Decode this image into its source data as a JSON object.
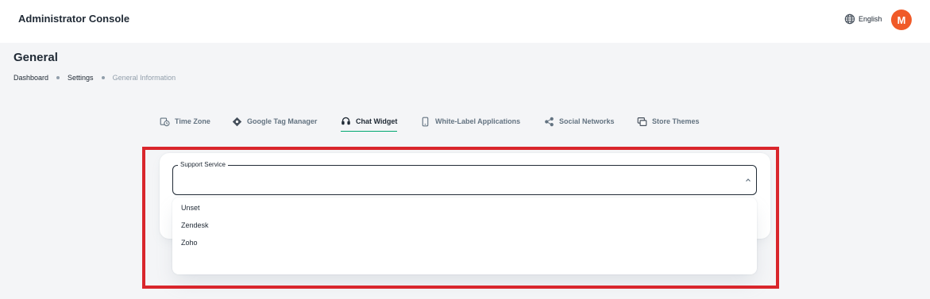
{
  "header": {
    "app_title": "Administrator Console",
    "language": "English",
    "avatar_initial": "M"
  },
  "page": {
    "title": "General",
    "breadcrumb": [
      "Dashboard",
      "Settings",
      "General Information"
    ]
  },
  "tabs": [
    {
      "label": "Time Zone",
      "icon": "clock-calendar-icon",
      "active": false
    },
    {
      "label": "Google Tag Manager",
      "icon": "tag-diamond-icon",
      "active": false
    },
    {
      "label": "Chat Widget",
      "icon": "headset-icon",
      "active": true
    },
    {
      "label": "White-Label Applications",
      "icon": "mobile-phone-icon",
      "active": false
    },
    {
      "label": "Social Networks",
      "icon": "share-icon",
      "active": false
    },
    {
      "label": "Store Themes",
      "icon": "themes-icon",
      "active": false
    }
  ],
  "support_service": {
    "label": "Support Service",
    "value": "",
    "options": [
      "Unset",
      "Zendesk",
      "Zoho"
    ]
  },
  "colors": {
    "accent": "#00a76f",
    "avatar": "#f05a28",
    "highlight": "#d9262c"
  }
}
